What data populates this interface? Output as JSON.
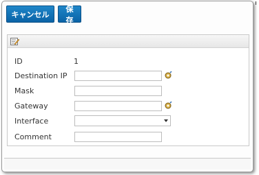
{
  "toolbar": {
    "cancel_label": "キャンセル",
    "save_label": "保存"
  },
  "form": {
    "fields": [
      {
        "label": "ID",
        "value": "1"
      },
      {
        "label": "Destination IP",
        "value": ""
      },
      {
        "label": "Mask",
        "value": ""
      },
      {
        "label": "Gateway",
        "value": ""
      },
      {
        "label": "Interface",
        "value": ""
      },
      {
        "label": "Comment",
        "value": ""
      }
    ]
  },
  "colors": {
    "button_bg": "#0a63a6",
    "button_text": "#ffffff"
  },
  "icons": {
    "toolbar": "edit-icon",
    "address_picker": "gear-icon",
    "dropdown": "chevron-down-icon"
  }
}
